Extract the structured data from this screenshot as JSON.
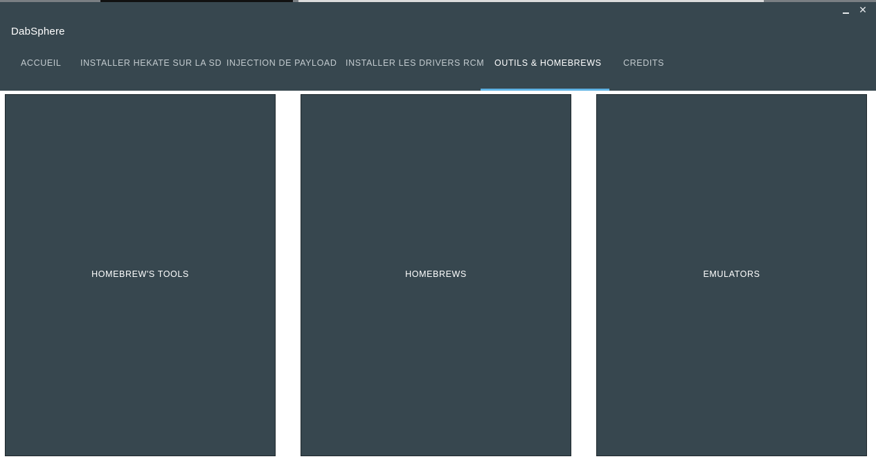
{
  "app": {
    "title": "DabSphere"
  },
  "window_controls": {
    "minimize_icon": "minimize-icon",
    "close_glyph": "✕"
  },
  "tabs": [
    {
      "label": "ACCUEIL",
      "active": false
    },
    {
      "label": "INSTALLER HEKATE SUR LA SD",
      "active": false
    },
    {
      "label": "INJECTION DE PAYLOAD",
      "active": false
    },
    {
      "label": "INSTALLER LES DRIVERS RCM",
      "active": false
    },
    {
      "label": "OUTILS & HOMEBREWS",
      "active": true
    },
    {
      "label": "CREDITS",
      "active": false
    }
  ],
  "panels": [
    {
      "label": "HOMEBREW'S TOOLS"
    },
    {
      "label": "HOMEBREWS"
    },
    {
      "label": "EMULATORS"
    }
  ],
  "colors": {
    "primary": "#37474f",
    "accent_indicator": "#5fb3e4",
    "text_active": "#ffffff",
    "text_inactive": "#c3cbcf",
    "background": "#ffffff"
  }
}
